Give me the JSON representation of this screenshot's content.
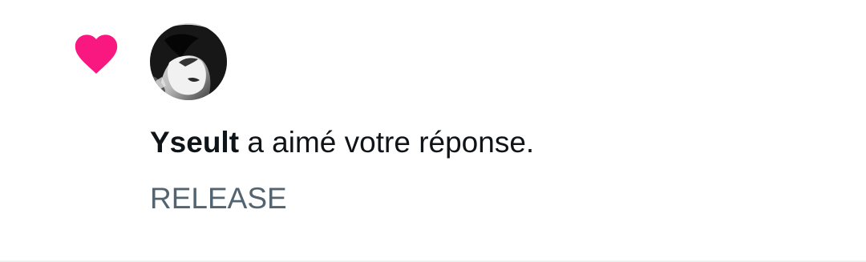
{
  "notification": {
    "type_icon": "heart-icon",
    "icon_color": "#f91880",
    "user_name": "Yseult",
    "action_text": " a aimé votre réponse.",
    "context_text": "RELEASE"
  },
  "colors": {
    "primary_text": "#0f1419",
    "secondary_text": "#536471",
    "divider": "#eff3f4"
  }
}
